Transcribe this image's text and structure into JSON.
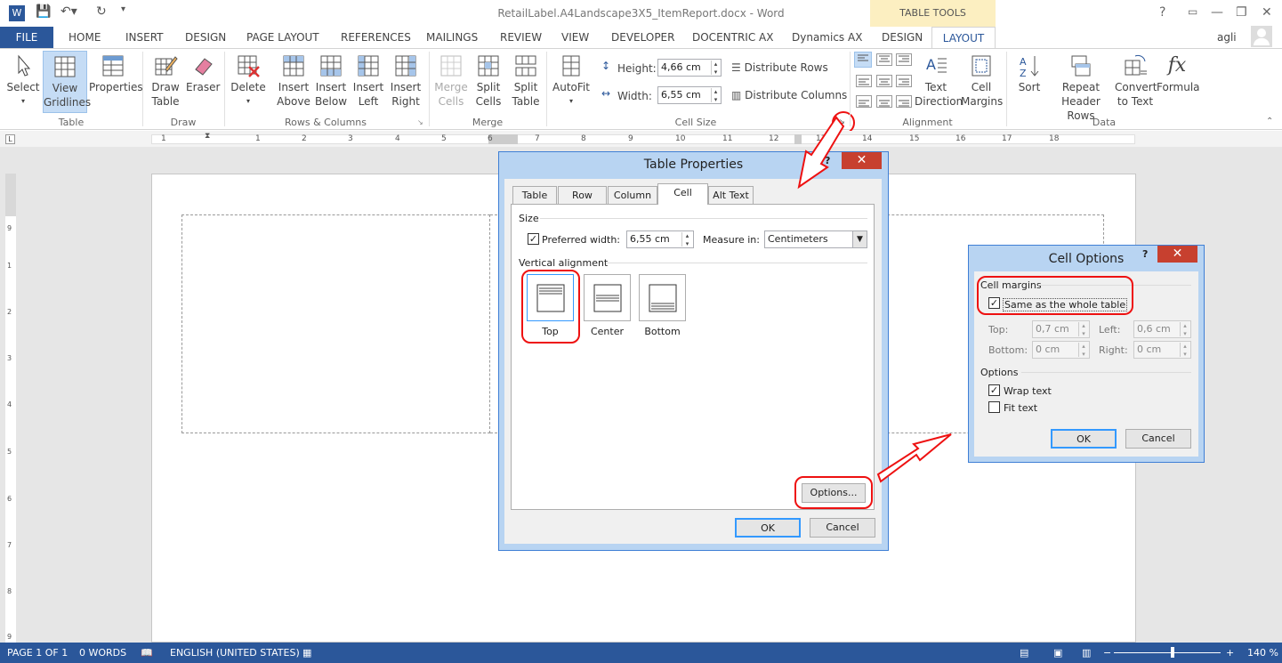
{
  "window": {
    "title": "RetailLabel.A4Landscape3X5_ItemReport.docx - Word",
    "help": "?",
    "minimize": "—",
    "restore": "❐",
    "close": "✕",
    "user": "agli",
    "table_tools": "TABLE TOOLS"
  },
  "tabs": [
    "FILE",
    "HOME",
    "INSERT",
    "DESIGN",
    "PAGE LAYOUT",
    "REFERENCES",
    "MAILINGS",
    "REVIEW",
    "VIEW",
    "DEVELOPER",
    "DOCENTRIC AX",
    "Dynamics AX",
    "DESIGN",
    "LAYOUT"
  ],
  "ribbon": {
    "table": {
      "label": "Table",
      "select": "Select",
      "view_gridlines_1": "View",
      "view_gridlines_2": "Gridlines",
      "properties": "Properties"
    },
    "draw": {
      "label": "Draw",
      "draw_table_1": "Draw",
      "draw_table_2": "Table",
      "eraser": "Eraser"
    },
    "rows_cols": {
      "label": "Rows & Columns",
      "delete": "Delete",
      "insert_above_1": "Insert",
      "insert_above_2": "Above",
      "insert_below_1": "Insert",
      "insert_below_2": "Below",
      "insert_left_1": "Insert",
      "insert_left_2": "Left",
      "insert_right_1": "Insert",
      "insert_right_2": "Right"
    },
    "merge": {
      "label": "Merge",
      "merge_cells_1": "Merge",
      "merge_cells_2": "Cells",
      "split_cells_1": "Split",
      "split_cells_2": "Cells",
      "split_table_1": "Split",
      "split_table_2": "Table"
    },
    "cell_size": {
      "label": "Cell Size",
      "autofit": "AutoFit",
      "height_label": "Height:",
      "height_value": "4,66 cm",
      "width_label": "Width:",
      "width_value": "6,55 cm",
      "distribute_rows": "Distribute Rows",
      "distribute_columns": "Distribute Columns"
    },
    "alignment": {
      "label": "Alignment",
      "text_direction_1": "Text",
      "text_direction_2": "Direction",
      "cell_margins_1": "Cell",
      "cell_margins_2": "Margins"
    },
    "data": {
      "label": "Data",
      "sort": "Sort",
      "repeat_header_1": "Repeat",
      "repeat_header_2": "Header Rows",
      "convert_1": "Convert",
      "convert_2": "to Text",
      "formula": "Formula"
    }
  },
  "ruler_numbers": [
    "1",
    "1",
    "2",
    "3",
    "4",
    "5",
    "6",
    "7",
    "8",
    "9",
    "10",
    "11",
    "12",
    "13",
    "14",
    "15",
    "16",
    "17",
    "18"
  ],
  "vruler_numbers": [
    "9",
    "1",
    "2",
    "3",
    "4",
    "5",
    "6",
    "7",
    "8",
    "9"
  ],
  "table_properties": {
    "title": "Table Properties",
    "help": "?",
    "tabs": [
      "Table",
      "Row",
      "Column",
      "Cell",
      "Alt Text"
    ],
    "size_label": "Size",
    "preferred_width_label": "Preferred width:",
    "preferred_width_value": "6,55 cm",
    "measure_in_label": "Measure in:",
    "measure_in_value": "Centimeters",
    "vertical_alignment_label": "Vertical alignment",
    "align_top": "Top",
    "align_center": "Center",
    "align_bottom": "Bottom",
    "options_button": "Options...",
    "ok": "OK",
    "cancel": "Cancel"
  },
  "cell_options": {
    "title": "Cell Options",
    "help": "?",
    "cell_margins_label": "Cell margins",
    "same_as_table": "Same as the whole table",
    "top_label": "Top:",
    "top_value": "0,7 cm",
    "bottom_label": "Bottom:",
    "bottom_value": "0 cm",
    "left_label": "Left:",
    "left_value": "0,6 cm",
    "right_label": "Right:",
    "right_value": "0 cm",
    "options_label": "Options",
    "wrap_text": "Wrap text",
    "fit_text": "Fit text",
    "ok": "OK",
    "cancel": "Cancel"
  },
  "status": {
    "page": "PAGE 1 OF 1",
    "words": "0 WORDS",
    "language": "ENGLISH (UNITED STATES)",
    "zoom": "140 %"
  },
  "colors": {
    "accent": "#2b579a",
    "annotation": "#e11111",
    "contextual": "#fcefc1"
  }
}
